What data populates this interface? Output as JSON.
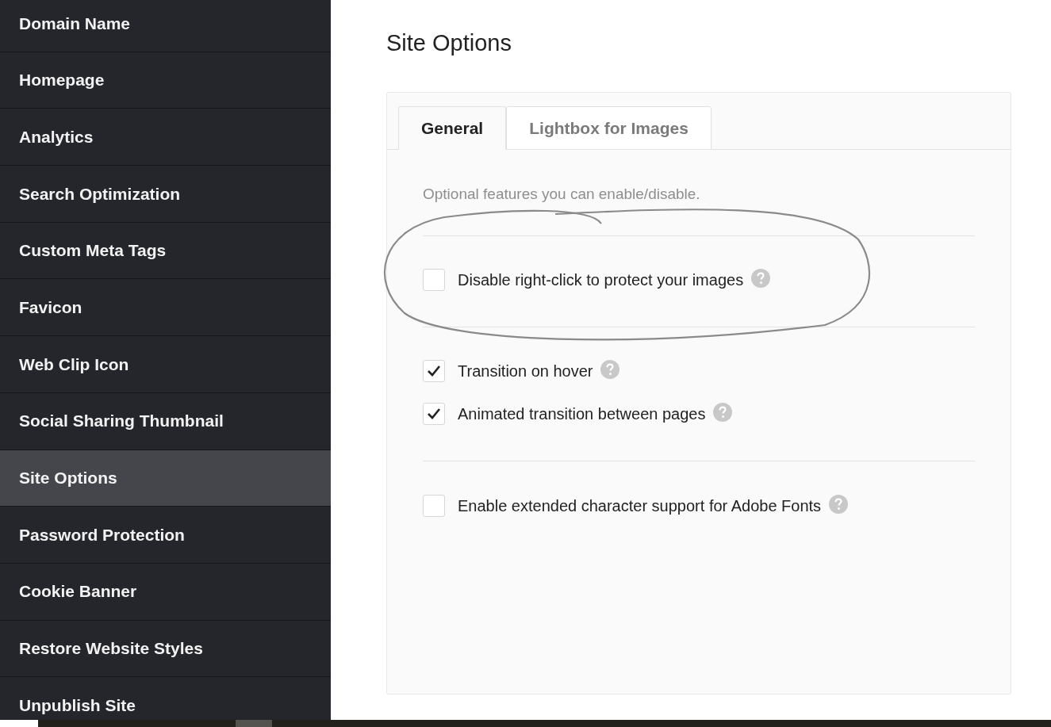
{
  "sidebar": {
    "items": [
      {
        "label": "Domain Name",
        "selected": false
      },
      {
        "label": "Homepage",
        "selected": false
      },
      {
        "label": "Analytics",
        "selected": false
      },
      {
        "label": "Search Optimization",
        "selected": false
      },
      {
        "label": "Custom Meta Tags",
        "selected": false
      },
      {
        "label": "Favicon",
        "selected": false
      },
      {
        "label": "Web Clip Icon",
        "selected": false
      },
      {
        "label": "Social Sharing Thumbnail",
        "selected": false
      },
      {
        "label": "Site Options",
        "selected": true
      },
      {
        "label": "Password Protection",
        "selected": false
      },
      {
        "label": "Cookie Banner",
        "selected": false
      },
      {
        "label": "Restore Website Styles",
        "selected": false
      },
      {
        "label": "Unpublish Site",
        "selected": false
      }
    ]
  },
  "page": {
    "title": "Site Options"
  },
  "tabs": [
    {
      "label": "General",
      "selected": true
    },
    {
      "label": "Lightbox for Images",
      "selected": false
    }
  ],
  "description": "Optional features you can enable/disable.",
  "option_groups": [
    [
      {
        "label": "Disable right-click to protect your images",
        "checked": false
      }
    ],
    [
      {
        "label": "Transition on hover",
        "checked": true
      },
      {
        "label": "Animated transition between pages",
        "checked": true
      }
    ],
    [
      {
        "label": "Enable extended character support for Adobe Fonts",
        "checked": false
      }
    ]
  ]
}
